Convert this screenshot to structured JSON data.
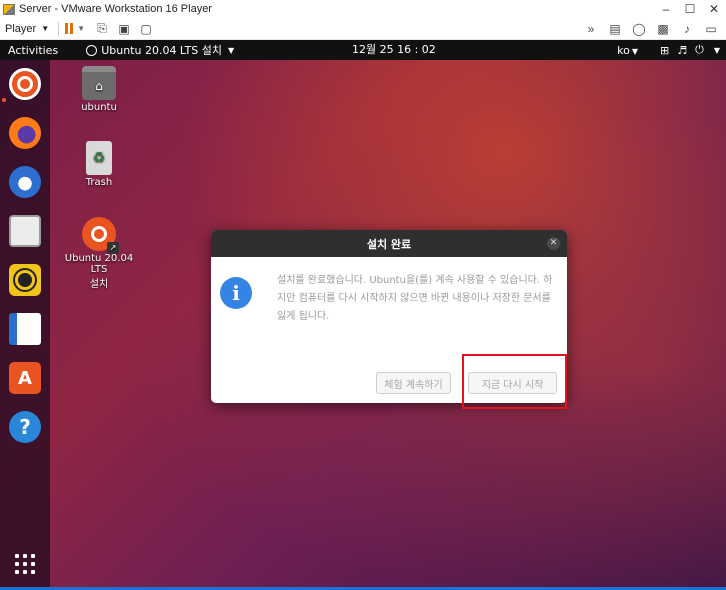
{
  "host": {
    "title": "Server - VMware Workstation 16 Player",
    "player_label": "Player",
    "accent_color": "#e07000"
  },
  "topbar": {
    "activities": "Activities",
    "app_menu_label": "Ubuntu 20.04 LTS 설치",
    "clock": "12월 25  16 : 02",
    "input_method": "ko"
  },
  "dock": {
    "items": [
      "ubuntu-installer-icon",
      "firefox-icon",
      "thunderbird-icon",
      "files-icon",
      "rhythmbox-icon",
      "libreoffice-writer-icon",
      "ubuntu-software-icon",
      "help-icon",
      "show-applications-icon"
    ]
  },
  "desktop": {
    "icons": [
      {
        "label": "ubuntu",
        "icon": "home-folder-icon"
      },
      {
        "label": "Trash",
        "icon": "trash-icon"
      },
      {
        "label": "Ubuntu 20.04 LTS\n설치",
        "icon": "installer-icon"
      }
    ]
  },
  "dialog": {
    "title": "설치 완료",
    "message": "설치를 완료했습니다. Ubuntu을(를) 계속 사용할 수 있습니다. 하지만 컴퓨터를 다시 시작하지 않으면 바뀐 내용이나 저장한 문서를 잃게 됩니다.",
    "continue_button": "체험 계속하기",
    "restart_button": "지금 다시 시작",
    "highlight_color": "#e0141e"
  }
}
